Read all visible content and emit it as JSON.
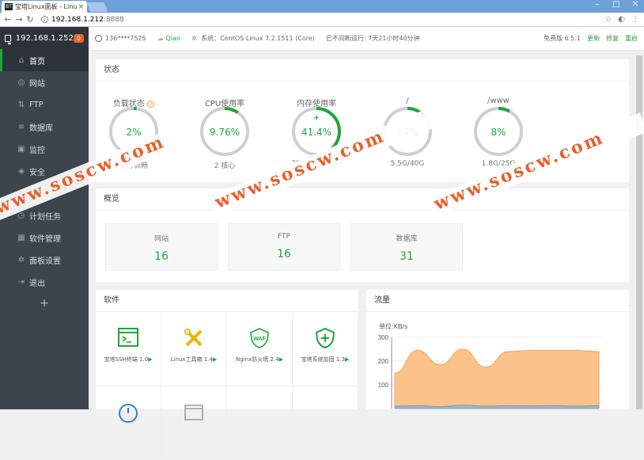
{
  "browser": {
    "tab_logo": "BT",
    "tab_title": "宝塔Linux面板 - Linux板",
    "tab_close": "×",
    "url_host": "192.168.1.212",
    "url_port": ":8888",
    "icon_names": [
      "back-icon",
      "forward-icon",
      "reload-icon",
      "info-icon",
      "star-icon",
      "extension-icon",
      "menu-icon"
    ]
  },
  "sidebar": {
    "ip": "192.168.1.252",
    "badge": "0",
    "items": [
      {
        "label": "首页",
        "icon": "home-icon",
        "glyph": "⌂",
        "active": true
      },
      {
        "label": "网站",
        "icon": "globe-icon",
        "glyph": "◎"
      },
      {
        "label": "FTP",
        "icon": "ftp-icon",
        "glyph": "⇅"
      },
      {
        "label": "数据库",
        "icon": "database-icon",
        "glyph": "≡"
      },
      {
        "label": "监控",
        "icon": "monitor-icon",
        "glyph": "▣"
      },
      {
        "label": "安全",
        "icon": "shield-icon",
        "glyph": "◈"
      },
      {
        "label": "文件",
        "icon": "folder-icon",
        "glyph": "▭"
      },
      {
        "label": "计划任务",
        "icon": "clock-icon",
        "glyph": "◷"
      },
      {
        "label": "软件管理",
        "icon": "grid-icon",
        "glyph": "▦"
      },
      {
        "label": "面板设置",
        "icon": "gear-icon",
        "glyph": "✲"
      },
      {
        "label": "退出",
        "icon": "logout-icon",
        "glyph": "⇥"
      }
    ],
    "add": "+"
  },
  "topinfo": {
    "user": "136****7525",
    "qiao": "Qiao",
    "system": "系统：CentOS Linux 7.2.1511 (Core)",
    "uptime": "已不间断运行: 7天21小时40分钟",
    "version": "免费版 6.5.1",
    "update": "更新",
    "repair": "修复",
    "restart": "重启"
  },
  "status": {
    "title": "状态",
    "gauges": [
      {
        "label": "负载状态",
        "value": "2%",
        "pct": 2,
        "sub": "运行流畅",
        "help": "?"
      },
      {
        "label": "CPU使用率",
        "value": "9.76%",
        "pct": 9.76,
        "sub": "2 核心"
      },
      {
        "label": "内存使用率",
        "value": "41.4%",
        "pct": 41.4,
        "sub": "759/1832(MB)",
        "rocket": "✈"
      },
      {
        "label": "/",
        "value": "14%",
        "pct": 14,
        "sub": "5.5G/40G"
      },
      {
        "label": "/www",
        "value": "8%",
        "pct": 8,
        "sub": "1.8G/25G"
      }
    ]
  },
  "stats": {
    "title": "概览",
    "boxes": [
      {
        "label": "网站",
        "value": "16"
      },
      {
        "label": "FTP",
        "value": "16"
      },
      {
        "label": "数据库",
        "value": "31"
      }
    ]
  },
  "software": {
    "title": "软件",
    "items": [
      {
        "name": "宝塔SSH终端 1.0",
        "icon": "terminal-icon",
        "arrow": "▶"
      },
      {
        "name": "Linux工具箱 1.4",
        "icon": "tools-icon",
        "arrow": "▶"
      },
      {
        "name": "Nginx防火墙 2.4",
        "icon": "waf-icon",
        "arrow": "▶",
        "badge": "WAF"
      },
      {
        "name": "宝塔系统加固 1.3",
        "icon": "shield-plus-icon",
        "arrow": "▶"
      }
    ]
  },
  "flow": {
    "title": "流量",
    "unit": "单位:KB/s"
  },
  "chart_data": {
    "type": "area",
    "ylabel": "单位:KB/s",
    "ylim": [
      0,
      300
    ],
    "yticks": [
      "300",
      "200",
      "100"
    ],
    "series": [
      {
        "values": [
          150,
          245,
          185,
          250,
          175,
          240,
          245,
          245,
          245,
          240
        ]
      },
      {
        "values": [
          10,
          12,
          8,
          14,
          10,
          12,
          11,
          12,
          10,
          12
        ]
      }
    ]
  },
  "watermark": {
    "text": "www.soscw.com"
  }
}
